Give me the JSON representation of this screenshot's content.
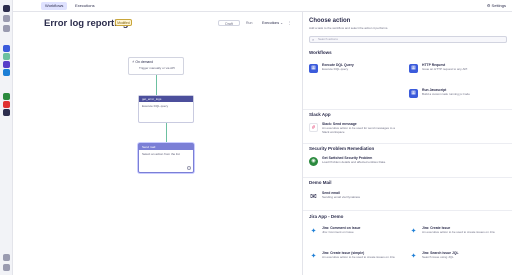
{
  "topbar": {
    "tabs": [
      {
        "label": "Workflows"
      },
      {
        "label": "Executions"
      }
    ],
    "settings_label": "Settings"
  },
  "header": {
    "title": "Error log reporting",
    "badge": "Modified",
    "draft_label": "Draft",
    "run_label": "Run",
    "executions_label": "Executions"
  },
  "canvas": {
    "trigger_title": "On demand",
    "trigger_desc": "Trigger manually or via API",
    "node1_title": "get_error_logs",
    "node1_desc": "Execute DQL query",
    "node2_title": "Send mail",
    "node2_desc": "Select an action from the list"
  },
  "panel": {
    "title": "Choose action",
    "subtitle": "Add a task to the workflow and select the action it performs.",
    "search_placeholder": "Search actions",
    "sections": [
      {
        "name": "Workflows",
        "actions": [
          {
            "name": "Execute DQL Query",
            "desc": "Execute DQL query",
            "icon": "grid-icon",
            "color": "#3b5bdb"
          },
          {
            "name": "HTTP Request",
            "desc": "Issue an HTTP request to any API",
            "icon": "grid-icon",
            "color": "#3b5bdb"
          },
          {
            "name": "Run Javascript",
            "desc": "Build a custom task running js Code",
            "icon": "grid-icon",
            "color": "#3b5bdb"
          }
        ]
      },
      {
        "name": "Slack App",
        "actions": [
          {
            "name": "Slack: Send message",
            "desc": "An executive action to be used for send messages to a Slack workspace",
            "icon": "slack-icon",
            "color": "#e01e5a"
          }
        ]
      },
      {
        "name": "Security Problem Remediation",
        "actions": [
          {
            "name": "Get Switched Security Problem",
            "desc": "Load Problem details and affected entities Data.",
            "icon": "security-icon",
            "color": "#2b8a3e"
          }
        ]
      },
      {
        "name": "Demo Mail",
        "actions": [
          {
            "name": "Send email",
            "desc": "Sending email via Dynatrace",
            "icon": "mail-icon",
            "color": "#2c2d4d"
          }
        ]
      },
      {
        "name": "Jira App - Demo",
        "actions": [
          {
            "name": "Jira: Comment on Issue",
            "desc": "Jira: Comment on Issue",
            "icon": "jira-icon",
            "color": "#1c7ed6"
          },
          {
            "name": "Jira: Create Issue",
            "desc": "An executive action to be used to create issues on Jira",
            "icon": "jira-icon",
            "color": "#1c7ed6"
          },
          {
            "name": "Jira: Create issue (simple)",
            "desc": "An executive action to be used to create issues on Jira",
            "icon": "jira-icon",
            "color": "#1c7ed6"
          },
          {
            "name": "Jira: Search issue JQL",
            "desc": "Search issue using JQL",
            "icon": "jira-icon",
            "color": "#1c7ed6"
          }
        ]
      }
    ]
  },
  "colors": {
    "accent": "#3b5bdb",
    "node_header": "#4c4f9c",
    "connector": "#6cc0a0"
  }
}
